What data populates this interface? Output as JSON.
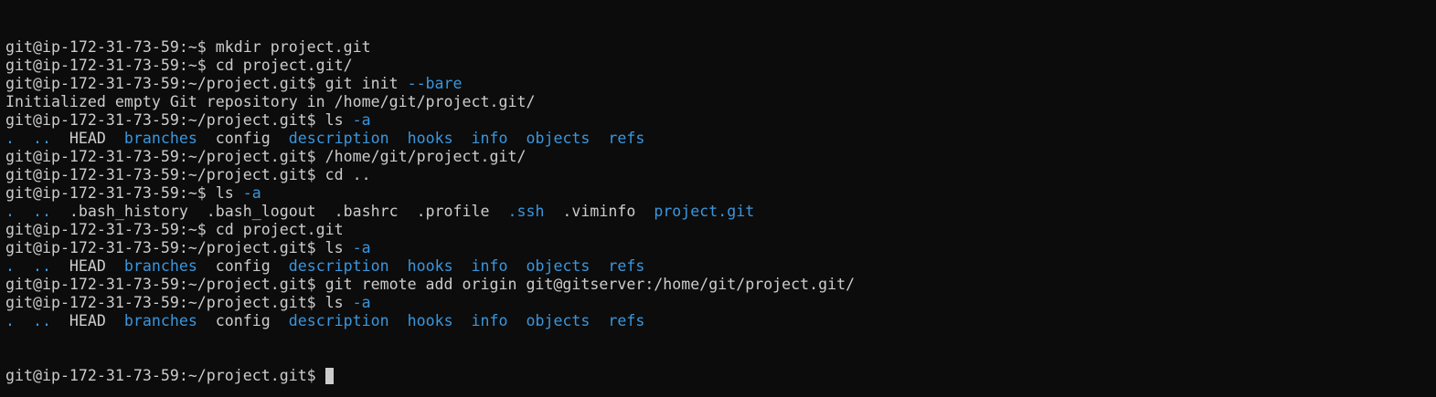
{
  "colors": {
    "background": "#0c0c0c",
    "foreground": "#cccccc",
    "directory_blue": "#3a96dd",
    "cursor": "#cccccc"
  },
  "terminal": {
    "lines": [
      {
        "segments": [
          {
            "t": "git@ip-172-31-73-59:~$ mkdir project.git",
            "c": "white"
          }
        ]
      },
      {
        "segments": [
          {
            "t": "git@ip-172-31-73-59:~$ cd project.git/",
            "c": "white"
          }
        ]
      },
      {
        "segments": [
          {
            "t": "git@ip-172-31-73-59:~/project.git$ git init ",
            "c": "white"
          },
          {
            "t": "--bare",
            "c": "blue"
          }
        ]
      },
      {
        "segments": [
          {
            "t": "Initialized empty Git repository in /home/git/project.git/",
            "c": "white"
          }
        ]
      },
      {
        "segments": [
          {
            "t": "git@ip-172-31-73-59:~/project.git$ ls ",
            "c": "white"
          },
          {
            "t": "-a",
            "c": "blue"
          }
        ]
      },
      {
        "segments": [
          {
            "t": ".  ..",
            "c": "blue"
          },
          {
            "t": "  HEAD  ",
            "c": "white"
          },
          {
            "t": "branches",
            "c": "blue"
          },
          {
            "t": "  config  ",
            "c": "white"
          },
          {
            "t": "description  hooks  info  objects  refs",
            "c": "blue"
          }
        ]
      },
      {
        "segments": [
          {
            "t": "git@ip-172-31-73-59:~/project.git$ /home/git/project.git/",
            "c": "white"
          }
        ]
      },
      {
        "segments": [
          {
            "t": "git@ip-172-31-73-59:~/project.git$ cd ..",
            "c": "white"
          }
        ]
      },
      {
        "segments": [
          {
            "t": "git@ip-172-31-73-59:~$ ls ",
            "c": "white"
          },
          {
            "t": "-a",
            "c": "blue"
          }
        ]
      },
      {
        "segments": [
          {
            "t": ".  ..",
            "c": "blue"
          },
          {
            "t": "  .bash_history  .bash_logout  .bashrc  .profile  ",
            "c": "white"
          },
          {
            "t": ".ssh",
            "c": "blue"
          },
          {
            "t": "  .viminfo  ",
            "c": "white"
          },
          {
            "t": "project.git",
            "c": "blue"
          }
        ]
      },
      {
        "segments": [
          {
            "t": "git@ip-172-31-73-59:~$ cd project.git",
            "c": "white"
          }
        ]
      },
      {
        "segments": [
          {
            "t": "git@ip-172-31-73-59:~/project.git$ ls ",
            "c": "white"
          },
          {
            "t": "-a",
            "c": "blue"
          }
        ]
      },
      {
        "segments": [
          {
            "t": ".  ..",
            "c": "blue"
          },
          {
            "t": "  HEAD  ",
            "c": "white"
          },
          {
            "t": "branches",
            "c": "blue"
          },
          {
            "t": "  config  ",
            "c": "white"
          },
          {
            "t": "description  hooks  info  objects  refs",
            "c": "blue"
          }
        ]
      },
      {
        "segments": [
          {
            "t": "git@ip-172-31-73-59:~/project.git$ git remote add origin git@gitserver:/home/git/project.git/",
            "c": "white"
          }
        ]
      },
      {
        "segments": [
          {
            "t": "git@ip-172-31-73-59:~/project.git$ ls ",
            "c": "white"
          },
          {
            "t": "-a",
            "c": "blue"
          }
        ]
      },
      {
        "segments": [
          {
            "t": ".  ..",
            "c": "blue"
          },
          {
            "t": "  HEAD  ",
            "c": "white"
          },
          {
            "t": "branches",
            "c": "blue"
          },
          {
            "t": "  config  ",
            "c": "white"
          },
          {
            "t": "description  hooks  info  objects  refs",
            "c": "blue"
          }
        ]
      }
    ],
    "prompt": "git@ip-172-31-73-59:~/project.git$ ",
    "cursor_icon": "block-cursor"
  }
}
